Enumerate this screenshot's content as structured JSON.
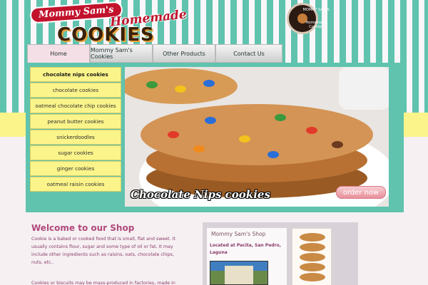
{
  "logo": {
    "brand": "Mommy Sam's",
    "tagline": "Homemade",
    "word": "COOKIES",
    "badge_top": "MOMMY SAM'S",
    "badge_bottom": "Homemade Cookies"
  },
  "nav": {
    "items": [
      {
        "label": "Home",
        "active": true
      },
      {
        "label": "Mommy Sam's Cookies"
      },
      {
        "label": "Other Products"
      },
      {
        "label": "Contact Us"
      }
    ]
  },
  "menu": {
    "items": [
      {
        "label": "chocolate nips cookies"
      },
      {
        "label": "chocolate cookies"
      },
      {
        "label": "oatmeal chocolate chip cookies"
      },
      {
        "label": "peanut butter cookies"
      },
      {
        "label": "snickerdoodles"
      },
      {
        "label": "sugar cookies"
      },
      {
        "label": "ginger cookies"
      },
      {
        "label": "oatmeal raisin cookies"
      }
    ]
  },
  "hero": {
    "caption": "Chocolate Nips cookies",
    "order_label": "order now"
  },
  "welcome": {
    "title": "Welcome to our Shop",
    "paragraph1": "Cookie is a baked or cooked food that is small, flat and sweet. It usually contains flour, sugar and some type of oil or fat. It may include other ingredients such as raisins, oats, chocolate chips, nuts, etc..",
    "paragraph2": "Cookies or biscuits may be mass-produced in factories, made in"
  },
  "shop": {
    "title": "Mommy Sam's Shop",
    "location": "Located at Pacita, San Pedro, Laguna"
  },
  "colors": {
    "teal": "#5fc3ae",
    "yellow": "#fbf48a",
    "pink_text": "#b04a7a",
    "brand_red": "#c2122c"
  }
}
